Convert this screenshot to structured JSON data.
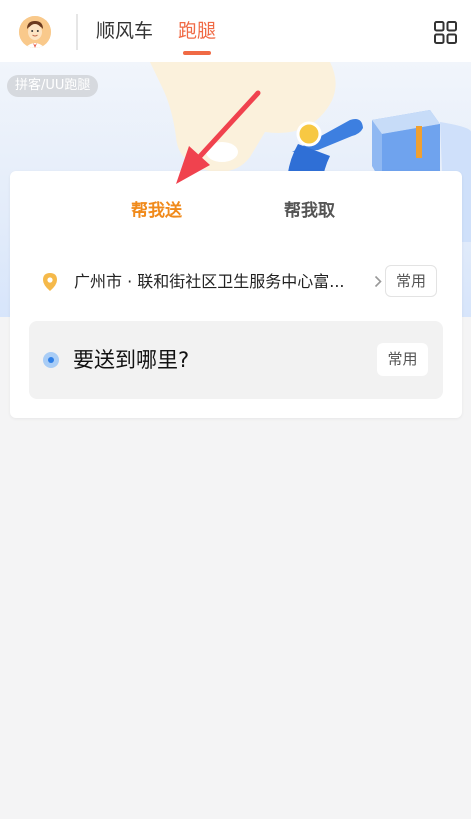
{
  "header": {
    "tabs": [
      {
        "label": "顺风车"
      },
      {
        "label": "跑腿"
      }
    ]
  },
  "banner": {
    "source_tag": "拼客/UU跑腿"
  },
  "order_card": {
    "modes": [
      {
        "label": "帮我送",
        "active": true
      },
      {
        "label": "帮我取",
        "active": false
      }
    ],
    "pickup": {
      "address": "广州市 · 联和街社区卫生服务中心富...",
      "favorite_label": "常用"
    },
    "destination": {
      "placeholder": "要送到哪里?",
      "favorite_label": "常用"
    }
  },
  "colors": {
    "accent": "#f06a45",
    "mode_active": "#f08a1b",
    "annotation_arrow": "#f0424e"
  }
}
